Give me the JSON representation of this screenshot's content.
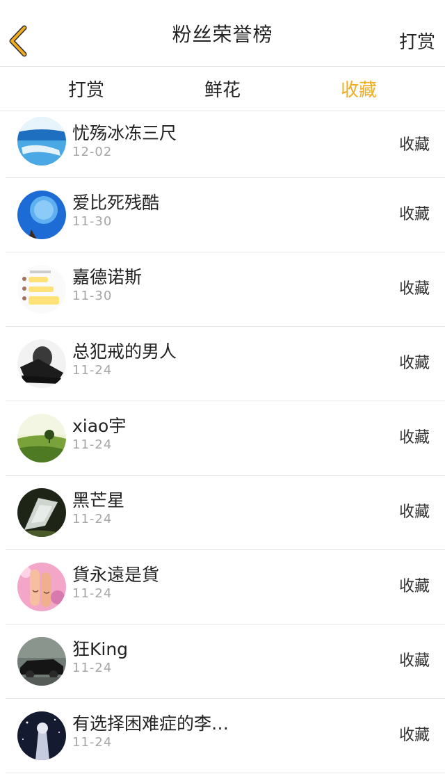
{
  "nav": {
    "title": "粉丝荣誉榜",
    "right_label": "打赏",
    "back_icon": "chevron-left-icon",
    "back_color": "#f0ac1e"
  },
  "tabs": [
    {
      "label": "打赏",
      "active": false
    },
    {
      "label": "鲜花",
      "active": false
    },
    {
      "label": "收藏",
      "active": true
    }
  ],
  "accent_color": "#f0ac1e",
  "fans": [
    {
      "name": "忧殇冰冻三尺",
      "date": "12-02",
      "action": "收藏"
    },
    {
      "name": "爱比死残酷",
      "date": "11-30",
      "action": "收藏"
    },
    {
      "name": "嘉德诺斯",
      "date": "11-30",
      "action": "收藏"
    },
    {
      "name": "总犯戒的男人",
      "date": "11-24",
      "action": "收藏"
    },
    {
      "name": "xiao宇",
      "date": "11-24",
      "action": "收藏"
    },
    {
      "name": "黑芒星",
      "date": "11-24",
      "action": "收藏"
    },
    {
      "name": "貨永遠是貨",
      "date": "11-24",
      "action": "收藏"
    },
    {
      "name": "狂King",
      "date": "11-24",
      "action": "收藏"
    },
    {
      "name": "有选择困难症的李…",
      "date": "11-24",
      "action": "收藏"
    }
  ]
}
